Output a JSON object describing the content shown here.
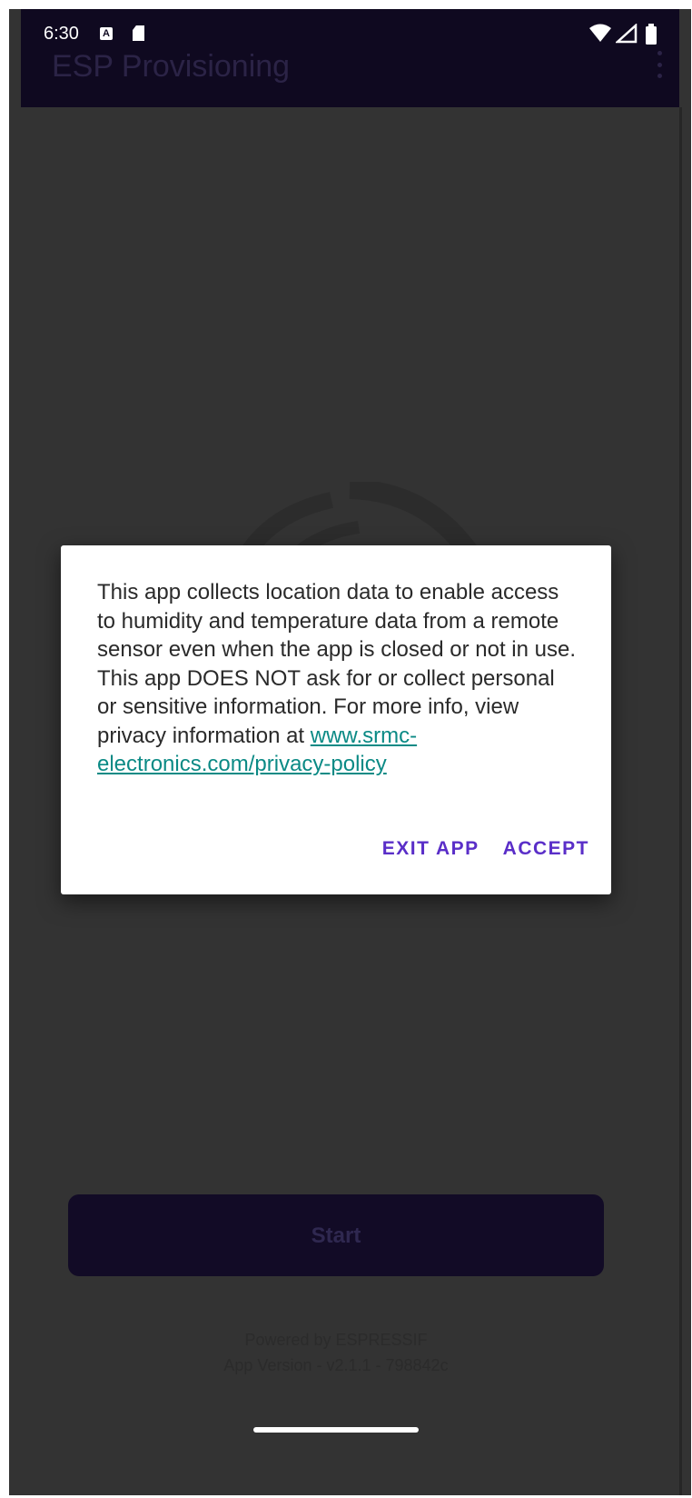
{
  "status_bar": {
    "time": "6:30",
    "notification_a": "A"
  },
  "app_bar": {
    "title": "ESP Provisioning"
  },
  "dialog": {
    "message": "This app collects location data to enable access to humidity and temperature data from a remote sensor even when the app is closed or not in use. This app DOES NOT ask for or collect personal or sensitive information. For more info, view privacy information at ",
    "link_text": "www.srmc-electronics.com/privacy-policy",
    "exit_label": "EXIT APP",
    "accept_label": "ACCEPT"
  },
  "main": {
    "start_label": "Start"
  },
  "footer": {
    "powered_by": "Powered by ESPRESSIF",
    "version": "App Version - v2.1.1 - 798842c"
  },
  "colors": {
    "accent": "#5a2ec8",
    "link": "#0b8a85",
    "app_bar": "#0f0920",
    "scrim": "#333333"
  }
}
